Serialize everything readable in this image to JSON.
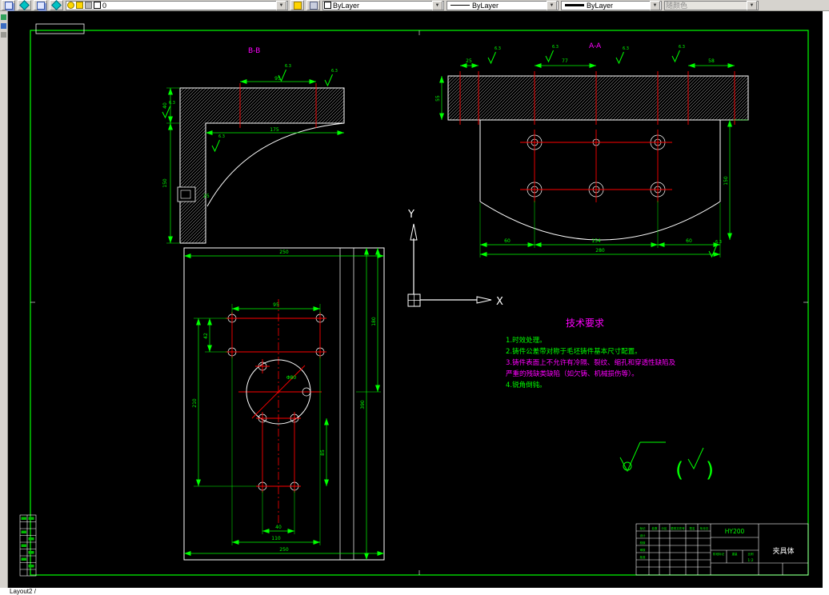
{
  "toolbar": {
    "layer_value": "0",
    "color_value": "ByLayer",
    "linetype_value": "ByLayer",
    "lineweight_value": "ByLayer",
    "plotstyle_value": "随颜色",
    "dropdown_arrow": "▼"
  },
  "status": {
    "layout_tab": "Layout2 /"
  },
  "drawing": {
    "section_b_label": "B-B",
    "section_a_label": "A-A",
    "axis_x_label": "X",
    "axis_y_label": "Y",
    "tech_title": "技术要求",
    "tech_lines": [
      {
        "text": "1.时效处理。",
        "color": "#00ff00"
      },
      {
        "text": "2.铸件公差带对称于毛坯铸件基本尺寸配置。",
        "color": "#00ff00"
      },
      {
        "text": "3.铸件表面上不允许有冷隔、裂纹、缩孔和穿透性缺陷及",
        "color": "#ff00ff"
      },
      {
        "text": "严重的残缺类缺陷（如欠铸、机械损伤等）。",
        "color": "#ff00ff"
      },
      {
        "text": "4.锐角倒钝。",
        "color": "#00ff00"
      }
    ],
    "finish_value": "6.3",
    "finish_paren_open": "(",
    "finish_paren_close": ")",
    "dims": [
      "40",
      "150",
      "175",
      "95",
      "25",
      "25",
      "77",
      "58",
      "55",
      "60",
      "154",
      "60",
      "280",
      "150",
      "95",
      "42",
      "210",
      "390",
      "180",
      "40",
      "110",
      "250",
      "85",
      "Φ80"
    ]
  },
  "title_block": {
    "code": "HY200",
    "part_name": "夹具体",
    "header_row": [
      "标记",
      "处数",
      "分区",
      "更改文件号",
      "签名",
      "年月日"
    ],
    "left_col": [
      "设计",
      "校核",
      "审核",
      "批准"
    ],
    "mid_row": [
      "阶段标记",
      "重量",
      "比例"
    ],
    "scale": "1:2"
  },
  "colors": {
    "dimension": "#00ff00",
    "centerline": "#ff0000",
    "outline": "#ffffff",
    "section_label": "#ff00ff"
  }
}
